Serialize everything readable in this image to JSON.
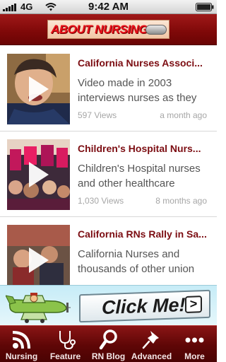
{
  "status_bar": {
    "carrier": "4G",
    "time": "9:42 AM"
  },
  "header": {
    "logo_text": "ABOUT NURSING"
  },
  "videos": [
    {
      "title": "California Nurses Associ...",
      "description": "Video made in 2003 interviews nurses as they",
      "views": "597 Views",
      "date": "a month ago"
    },
    {
      "title": "Children's Hospital Nurs...",
      "description": "Children's Hospital nurses and other healthcare",
      "views": "1,030 Views",
      "date": "8 months ago"
    },
    {
      "title": "California RNs Rally in Sa...",
      "description": "California Nurses and thousands of other union",
      "views": "",
      "date": ""
    }
  ],
  "ad": {
    "text": "Click Me!!!",
    "arrow": ">"
  },
  "tabs": [
    {
      "label": "Nursing",
      "icon": "rss-icon"
    },
    {
      "label": "Feature",
      "icon": "stethoscope-icon"
    },
    {
      "label": "RN Blog",
      "icon": "magnifier-icon"
    },
    {
      "label": "Advanced",
      "icon": "pushpin-icon"
    },
    {
      "label": "More",
      "icon": "more-dots-icon"
    }
  ]
}
